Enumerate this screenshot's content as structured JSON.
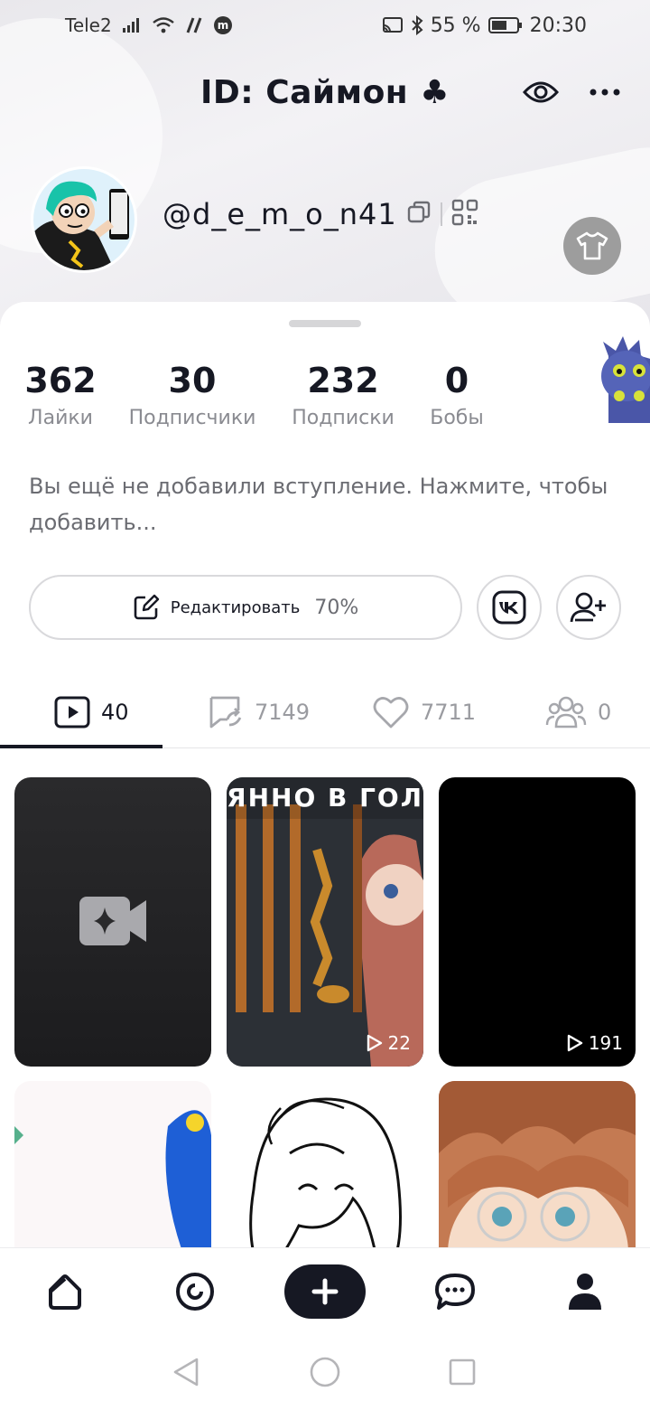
{
  "status_bar": {
    "carrier": "Tele2",
    "battery_percent": "55 %",
    "time": "20:30"
  },
  "header": {
    "title": "ID: Саймон ♣",
    "icons": [
      "eye-icon",
      "more-icon"
    ]
  },
  "profile": {
    "username": "@d_e_m_o_n41",
    "stats": [
      {
        "value": "362",
        "label": "Лайки"
      },
      {
        "value": "30",
        "label": "Подписчики"
      },
      {
        "value": "232",
        "label": "Подписки"
      },
      {
        "value": "0",
        "label": "Бобы"
      }
    ],
    "bio_placeholder": "Вы ещё не добавили вступление. Нажмите, чтобы добавить...",
    "edit_label": "Редактировать",
    "profile_completion": "70%"
  },
  "tabs": [
    {
      "icon": "video-icon",
      "count": "40",
      "active": true
    },
    {
      "icon": "repost-icon",
      "count": "7149",
      "active": false
    },
    {
      "icon": "heart-icon",
      "count": "7711",
      "active": false
    },
    {
      "icon": "group-icon",
      "count": "0",
      "active": false
    }
  ],
  "videos": [
    {
      "kind": "draft",
      "views": ""
    },
    {
      "kind": "video",
      "caption": "ЯННО В ГОЛ",
      "views": "22"
    },
    {
      "kind": "video",
      "views": "191"
    },
    {
      "kind": "video",
      "views": ""
    },
    {
      "kind": "video",
      "views": ""
    },
    {
      "kind": "video",
      "views": ""
    }
  ],
  "bottom_nav": [
    "home-icon",
    "explore-icon",
    "create-icon",
    "messages-icon",
    "profile-icon"
  ],
  "colors": {
    "text_primary": "#161823",
    "text_secondary": "#8a8b91",
    "border": "#d9d9dc",
    "accent_dark": "#161823"
  }
}
